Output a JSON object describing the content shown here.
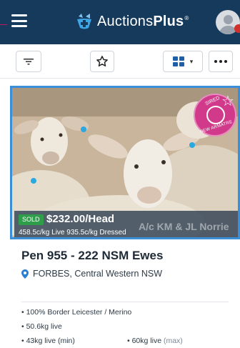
{
  "header": {
    "brand_name": "Auctions",
    "brand_name_bold": "Plus",
    "brand_mark": "®",
    "menu_icon": "hamburger-icon",
    "avatar_icon": "user-avatar-icon"
  },
  "toolbar": {
    "filter_icon": "filter-icon",
    "watchlist_icon": "star-outline-icon",
    "view_icon": "grid-view-icon",
    "view_dropdown_icon": "chevron-down-icon",
    "more_icon": "more-dots-icon"
  },
  "lot": {
    "image_description_icon": "sheep-photo",
    "badge_text_top": "SIRED",
    "badge_text_bottom": "NEW ARMATRE",
    "status": "SOLD",
    "price": "$232.00/Head",
    "weights": "458.5c/kg Live 935.5c/kg Dressed",
    "vendor": "A/c KM & JL Norrie",
    "title": "Pen 955 - 222 NSM Ewes",
    "location": "FORBES, Central Western NSW",
    "specs": {
      "breed": "100% Border Leicester / Merino",
      "live_weight": "50.6kg live",
      "min_weight": "43kg live (min)",
      "max_weight_value": "60kg live",
      "max_weight_suffix": "(max)"
    }
  },
  "colors": {
    "header_bg": "#163a5c",
    "accent_blue": "#3b8fd8",
    "sold_green": "#2e9e4a",
    "badge_pink": "#d13a8a"
  }
}
